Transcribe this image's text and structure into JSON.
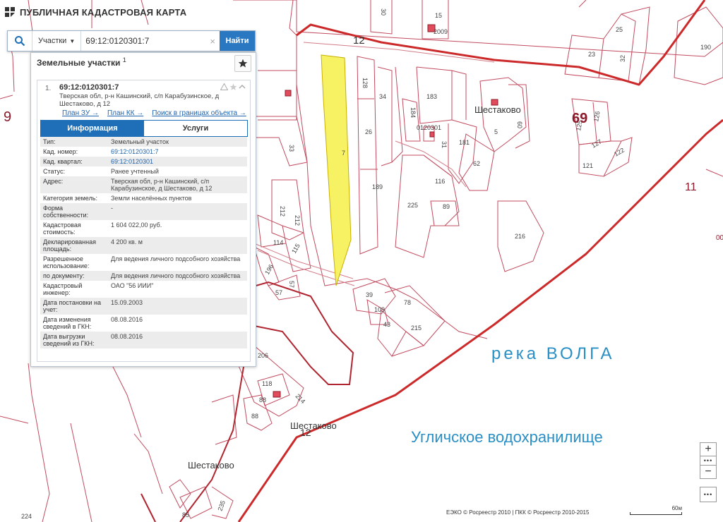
{
  "app": {
    "title": "ПУБЛИЧНАЯ КАДАСТРОВАЯ КАРТА"
  },
  "search": {
    "type_label": "Участки",
    "value": "69:12:0120301:7",
    "submit_label": "Найти",
    "clear_symbol": "×"
  },
  "panel": {
    "heading": "Земельные участки",
    "count": "1",
    "result": {
      "num": "1.",
      "id": "69:12:0120301:7",
      "address": "Тверская обл, р-н Кашинский, с/п Карабузинское, д Шестаково, д 12",
      "links": [
        "План ЗУ →",
        "План КК →",
        "Поиск в границах объекта →"
      ]
    },
    "tabs": [
      "Информация",
      "Услуги"
    ],
    "attributes": [
      {
        "key": "Тип:",
        "value": "Земельный участок"
      },
      {
        "key": "Кад. номер:",
        "value": "69:12:0120301:7"
      },
      {
        "key": "Кад. квартал:",
        "value": "69:12:0120301"
      },
      {
        "key": "Статус:",
        "value": "Ранее учтенный"
      },
      {
        "key": "Адрес:",
        "value": "Тверская обл, р-н Кашинский, с/п Карабузинское, д Шестаково, д 12"
      },
      {
        "key": "Категория земель:",
        "value": "Земли населённых пунктов"
      },
      {
        "key": "Форма собственности:",
        "value": "-"
      },
      {
        "key": "Кадастровая стоимость:",
        "value": "1 604 022,00 руб."
      },
      {
        "key": "Декларированная площадь:",
        "value": "4 200 кв. м"
      },
      {
        "key": "Разрешенное использование:",
        "value": "Для ведения личного подсобного хозяйства"
      },
      {
        "key": "по документу:",
        "value": "Для ведения личного подсобного хозяйства"
      },
      {
        "key": "Кадастровый инженер:",
        "value": "ОАО \"56 ИИИ\""
      },
      {
        "key": "Дата постановки на учет:",
        "value": "15.09.2003"
      },
      {
        "key": "Дата изменения сведений в ГКН:",
        "value": "08.08.2016"
      },
      {
        "key": "Дата выгрузки сведений из ГКН:",
        "value": "08.08.2016"
      }
    ]
  },
  "map": {
    "parcel_numbers": [
      "30",
      "15",
      "25",
      "23",
      "32",
      "190",
      "128",
      "34",
      "183",
      "184",
      "0120301",
      "31",
      "181",
      "5",
      "60",
      "62",
      "126",
      "125",
      "127",
      "121",
      "122",
      "26",
      "7",
      "189",
      "116",
      "225",
      "89",
      "216",
      "33",
      "212",
      "212",
      "114",
      "115",
      "196",
      "57",
      "57",
      "39",
      "109",
      "43",
      "78",
      "215",
      "206",
      "118",
      "214",
      "88",
      "88",
      "85",
      "235",
      "224",
      "2009"
    ],
    "block_numbers": [
      "69",
      "11",
      "9"
    ],
    "village_labels": [
      "Шестаково",
      "Шестаково",
      "Шестаково"
    ],
    "road_numbers": [
      "12",
      "12"
    ],
    "water_labels": [
      "река ВОЛГА",
      "Угличское водохранилище"
    ],
    "edge_labels": [
      "00"
    ],
    "colors": {
      "selected_parcel": "#f7f264",
      "boundary": "#cc2a2a",
      "parcel_line": "#c24b5f",
      "water_text": "#2a8fc4",
      "building": "#e24b5b"
    }
  },
  "controls": {
    "zoom_in": "+",
    "zoom_out": "−",
    "more": "•••"
  },
  "attribution": "ЕЭКО © Росреестр 2010 | ПКК © Росреестр 2010-2015",
  "scale": "60м"
}
